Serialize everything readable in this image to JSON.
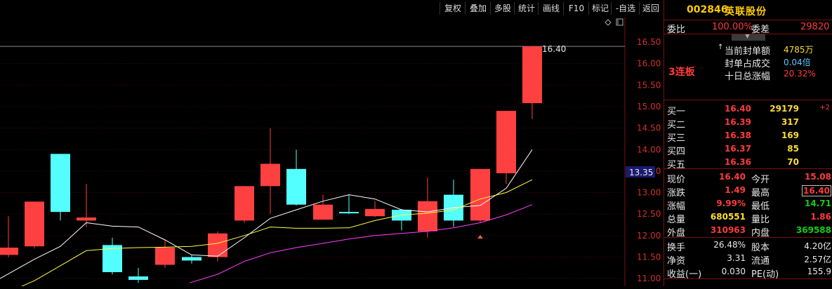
{
  "toolbar": {
    "items": [
      "复权",
      "叠加",
      "多股",
      "统计",
      "画线",
      "F10",
      "标记",
      "-自选",
      "返回"
    ]
  },
  "chart": {
    "price_axis": [
      "16.50",
      "16.00",
      "15.50",
      "15.00",
      "14.50",
      "14.00",
      "13.50",
      "13.00",
      "12.50",
      "12.00",
      "11.50",
      "11.00"
    ],
    "current_price_tag": "13.35",
    "peak_label": "16.40",
    "up_color": "#ff4040",
    "down_color": "#54ffff",
    "ma_colors": [
      "#ffffff",
      "#ffff40",
      "#ff40ff"
    ]
  },
  "stock": {
    "code": "002846",
    "name": "英联股份",
    "wei_bi_label": "委比",
    "wei_bi": "100.00%",
    "wei_cha_label": "委差",
    "wei_cha": "29820",
    "board_label": "3连板",
    "seal_amount_label": "当前封单额",
    "seal_amount": "4785万",
    "seal_ratio_label": "封单占成交",
    "seal_ratio": "0.04倍",
    "ten_day_label": "十日总涨幅",
    "ten_day": "20.32%"
  },
  "bids": [
    {
      "label": "买一",
      "price": "16.40",
      "vol": "29179",
      "chg": "+2"
    },
    {
      "label": "买二",
      "price": "16.39",
      "vol": "317",
      "chg": ""
    },
    {
      "label": "买三",
      "price": "16.38",
      "vol": "169",
      "chg": ""
    },
    {
      "label": "买四",
      "price": "16.37",
      "vol": "85",
      "chg": ""
    },
    {
      "label": "买五",
      "price": "16.36",
      "vol": "70",
      "chg": ""
    }
  ],
  "quote": [
    {
      "l1": "现价",
      "v1": "16.40",
      "l2": "今开",
      "v2": "15.08"
    },
    {
      "l1": "涨跌",
      "v1": "1.49",
      "l2": "最高",
      "v2": "16.40"
    },
    {
      "l1": "涨幅",
      "v1": "9.99%",
      "l2": "最低",
      "v2": "14.71"
    },
    {
      "l1": "总量",
      "v1": "680551",
      "l2": "量比",
      "v2": "1.86"
    },
    {
      "l1": "外盘",
      "v1": "310963",
      "l2": "内盘",
      "v2": "369588"
    }
  ],
  "fund": [
    {
      "l1": "换手",
      "v1": "26.48%",
      "l2": "股本",
      "v2": "4.20亿"
    },
    {
      "l1": "净资",
      "v1": "3.31",
      "l2": "流通",
      "v2": "2.57亿"
    },
    {
      "l1": "收益(一)",
      "v1": "0.030",
      "l2": "PE(动)",
      "v2": "155.9"
    }
  ]
}
